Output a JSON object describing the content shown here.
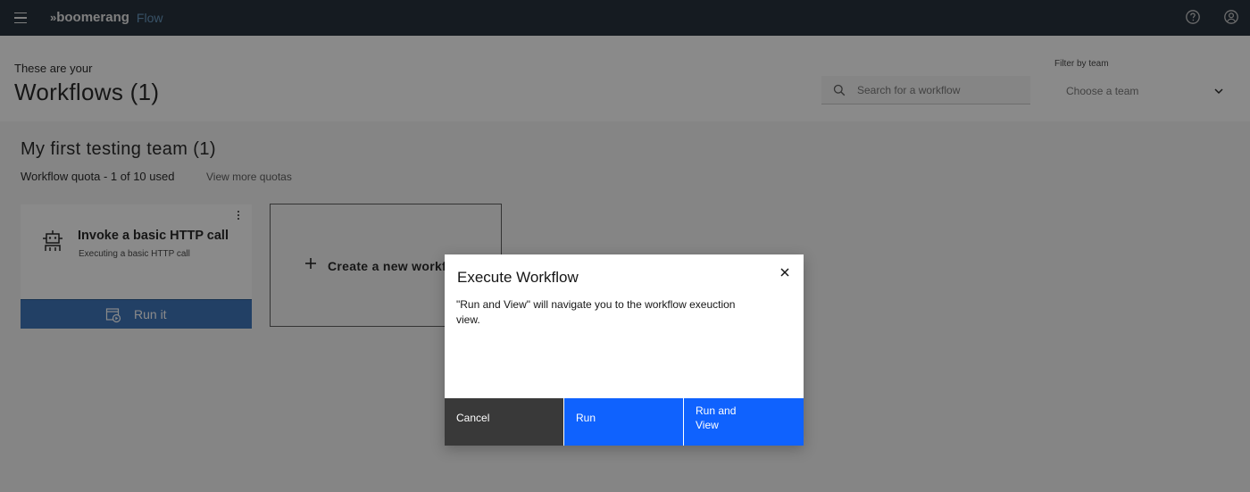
{
  "app": {
    "brand_chevron": "»",
    "brand_name": "boomerang",
    "product_name": "Flow"
  },
  "header": {
    "pre_title": "These are your",
    "title": "Workflows (1)",
    "search_placeholder": "Search for a workflow",
    "filter_label": "Filter by team",
    "filter_placeholder": "Choose a team"
  },
  "team": {
    "title": "My first testing team (1)",
    "quota": "Workflow quota - 1 of 10 used",
    "quota_link": "View more quotas"
  },
  "workflows": [
    {
      "name": "Invoke a basic HTTP call",
      "description": "Executing a basic HTTP call",
      "run_label": "Run it",
      "icon": "robot-icon"
    }
  ],
  "create_card": {
    "label": "Create a new workflow"
  },
  "modal": {
    "title": "Execute Workflow",
    "body": "\"Run and View\" will navigate you to the workflow exeuction view.",
    "cancel_label": "Cancel",
    "run_label": "Run",
    "run_view_label": "Run and View"
  },
  "colors": {
    "topbar": "#15202d",
    "primary": "#0f62fe",
    "secondary": "#393939",
    "overlay": "rgba(22,22,22,0.5)"
  }
}
